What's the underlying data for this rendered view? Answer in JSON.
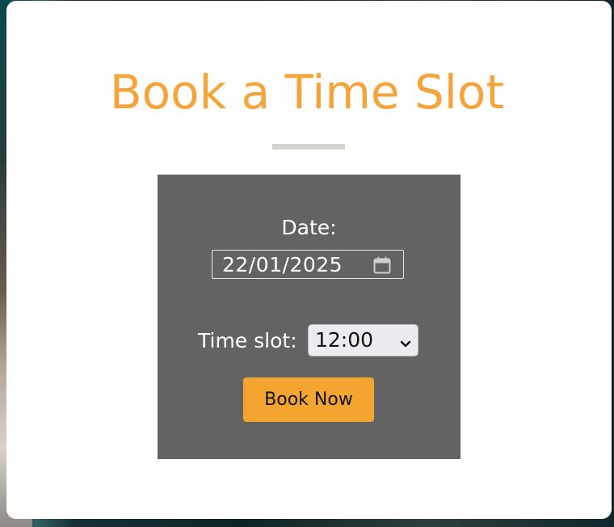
{
  "title": "Book a Time Slot",
  "form": {
    "date_label": "Date:",
    "date_value": "22/01/2025",
    "time_label": "Time slot:",
    "time_value": "12:00",
    "submit_label": "Book Now"
  },
  "colors": {
    "accent": "#f4a43a",
    "panel": "#636363",
    "divider": "#d6d6cd"
  },
  "icons": {
    "date": "calendar-icon",
    "select": "chevron-down-icon"
  }
}
